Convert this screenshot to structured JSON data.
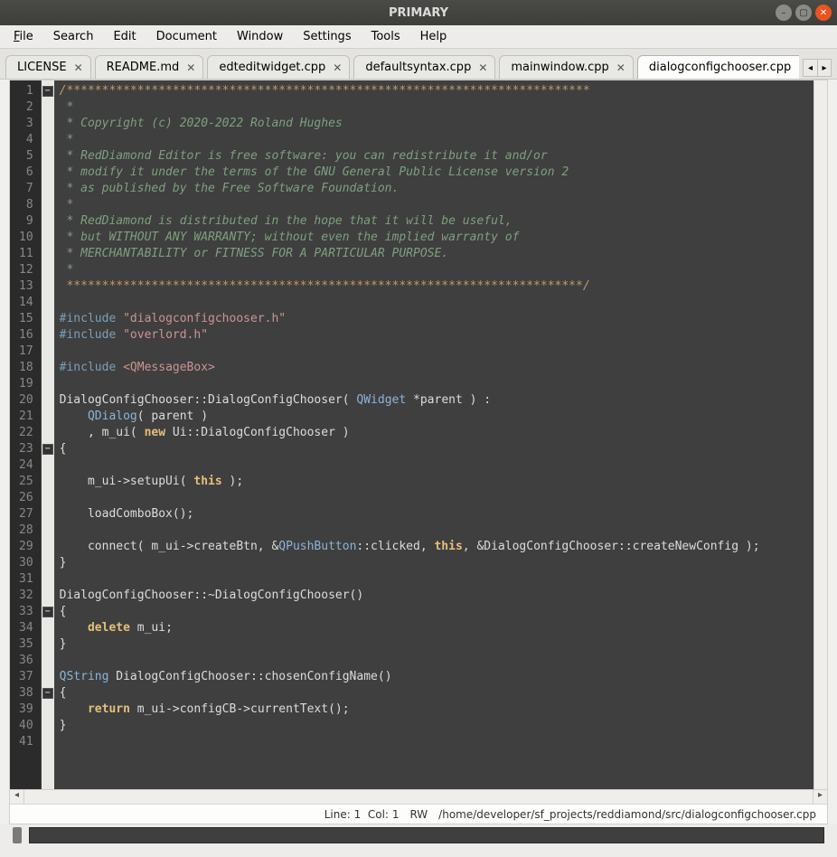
{
  "window": {
    "title": "PRIMARY"
  },
  "menu": {
    "items": [
      {
        "label": "File",
        "mnemonic": "F"
      },
      {
        "label": "Search",
        "mnemonic": ""
      },
      {
        "label": "Edit",
        "mnemonic": ""
      },
      {
        "label": "Document",
        "mnemonic": ""
      },
      {
        "label": "Window",
        "mnemonic": ""
      },
      {
        "label": "Settings",
        "mnemonic": ""
      },
      {
        "label": "Tools",
        "mnemonic": ""
      },
      {
        "label": "Help",
        "mnemonic": ""
      }
    ]
  },
  "tabs": {
    "items": [
      {
        "label": "LICENSE",
        "active": false
      },
      {
        "label": "README.md",
        "active": false
      },
      {
        "label": "edteditwidget.cpp",
        "active": false
      },
      {
        "label": "defaultsyntax.cpp",
        "active": false
      },
      {
        "label": "mainwindow.cpp",
        "active": false
      },
      {
        "label": "dialogconfigchooser.cpp",
        "active": true
      }
    ]
  },
  "editor": {
    "first_line": 1,
    "last_line": 41,
    "code_lines": [
      [
        {
          "cls": "cmts",
          "t": "/**************************************************************************"
        }
      ],
      [
        {
          "cls": "cmt",
          "t": " *"
        }
      ],
      [
        {
          "cls": "cmt",
          "t": " * Copyright (c) 2020-2022 Roland Hughes"
        }
      ],
      [
        {
          "cls": "cmt",
          "t": " *"
        }
      ],
      [
        {
          "cls": "cmt",
          "t": " * RedDiamond Editor is free software: you can redistribute it and/or"
        }
      ],
      [
        {
          "cls": "cmt",
          "t": " * modify it under the terms of the GNU General Public License version 2"
        }
      ],
      [
        {
          "cls": "cmt",
          "t": " * as published by the Free Software Foundation."
        }
      ],
      [
        {
          "cls": "cmt",
          "t": " *"
        }
      ],
      [
        {
          "cls": "cmt",
          "t": " * RedDiamond is distributed in the hope that it will be useful,"
        }
      ],
      [
        {
          "cls": "cmt",
          "t": " * but WITHOUT ANY WARRANTY; without even the implied warranty of"
        }
      ],
      [
        {
          "cls": "cmt",
          "t": " * MERCHANTABILITY or FITNESS FOR A PARTICULAR PURPOSE."
        }
      ],
      [
        {
          "cls": "cmt",
          "t": " *"
        }
      ],
      [
        {
          "cls": "cmts",
          "t": " *************************************************************************/"
        }
      ],
      [],
      [
        {
          "cls": "pp",
          "t": "#include "
        },
        {
          "cls": "str",
          "t": "\"dialogconfigchooser.h\""
        }
      ],
      [
        {
          "cls": "pp",
          "t": "#include "
        },
        {
          "cls": "str",
          "t": "\"overlord.h\""
        }
      ],
      [],
      [
        {
          "cls": "pp",
          "t": "#include "
        },
        {
          "cls": "str",
          "t": "<QMessageBox>"
        }
      ],
      [],
      [
        {
          "cls": "",
          "t": "DialogConfigChooser::DialogConfigChooser( "
        },
        {
          "cls": "type",
          "t": "QWidget"
        },
        {
          "cls": "",
          "t": " *parent ) :"
        }
      ],
      [
        {
          "cls": "",
          "t": "    "
        },
        {
          "cls": "type",
          "t": "QDialog"
        },
        {
          "cls": "",
          "t": "( parent )"
        }
      ],
      [
        {
          "cls": "",
          "t": "    , m_ui( "
        },
        {
          "cls": "kw",
          "t": "new"
        },
        {
          "cls": "",
          "t": " Ui::DialogConfigChooser )"
        }
      ],
      [
        {
          "cls": "",
          "t": "{"
        }
      ],
      [],
      [
        {
          "cls": "",
          "t": "    m_ui->setupUi( "
        },
        {
          "cls": "kw",
          "t": "this"
        },
        {
          "cls": "",
          "t": " );"
        }
      ],
      [],
      [
        {
          "cls": "",
          "t": "    loadComboBox();"
        }
      ],
      [],
      [
        {
          "cls": "",
          "t": "    connect( m_ui->createBtn, &"
        },
        {
          "cls": "type",
          "t": "QPushButton"
        },
        {
          "cls": "",
          "t": "::clicked, "
        },
        {
          "cls": "kw",
          "t": "this"
        },
        {
          "cls": "",
          "t": ", &DialogConfigChooser::createNewConfig );"
        }
      ],
      [
        {
          "cls": "",
          "t": "}"
        }
      ],
      [],
      [
        {
          "cls": "",
          "t": "DialogConfigChooser::~DialogConfigChooser()"
        }
      ],
      [
        {
          "cls": "",
          "t": "{"
        }
      ],
      [
        {
          "cls": "",
          "t": "    "
        },
        {
          "cls": "kw",
          "t": "delete"
        },
        {
          "cls": "",
          "t": " m_ui;"
        }
      ],
      [
        {
          "cls": "",
          "t": "}"
        }
      ],
      [],
      [
        {
          "cls": "type",
          "t": "QString"
        },
        {
          "cls": "",
          "t": " DialogConfigChooser::chosenConfigName()"
        }
      ],
      [
        {
          "cls": "",
          "t": "{"
        }
      ],
      [
        {
          "cls": "",
          "t": "    "
        },
        {
          "cls": "kw",
          "t": "return"
        },
        {
          "cls": "",
          "t": " m_ui->configCB->currentText();"
        }
      ],
      [
        {
          "cls": "",
          "t": "}"
        }
      ],
      []
    ],
    "fold_markers": {
      "1": true,
      "23": true,
      "33": true,
      "38": true
    }
  },
  "status": {
    "line_label": "Line:",
    "line": "1",
    "col_label": "Col:",
    "col": "1",
    "mode": "RW",
    "path": "/home/developer/sf_projects/reddiamond/src/dialogconfigchooser.cpp"
  }
}
